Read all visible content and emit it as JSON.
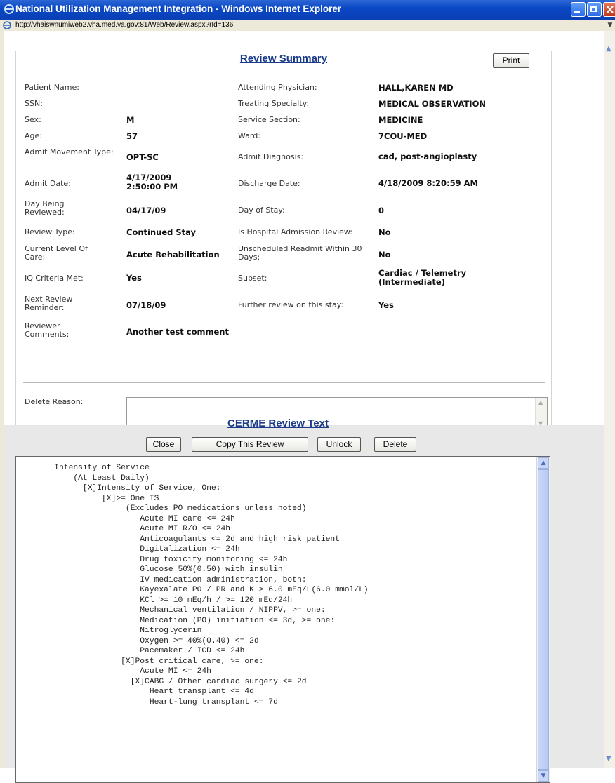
{
  "window": {
    "title": "National Utilization Management Integration - Windows Internet Explorer",
    "url": "http://vhaiswnumiweb2.vha.med.va.gov:81/Web/Review.aspx?rId=136"
  },
  "review_summary": {
    "heading": "Review Summary",
    "print_label": "Print",
    "left_fields": [
      {
        "label": "Patient Name:",
        "value": ""
      },
      {
        "label": "SSN:",
        "value": ""
      },
      {
        "label": "Sex:",
        "value": "M"
      },
      {
        "label": "Age:",
        "value": "57"
      },
      {
        "label": "Admit Movement Type:",
        "value": "OPT-SC"
      },
      {
        "label": "Admit Date:",
        "value": "4/17/2009 2:50:00 PM"
      },
      {
        "label": "Day Being Reviewed:",
        "value": "04/17/09"
      },
      {
        "label": "Review Type:",
        "value": "Continued Stay"
      },
      {
        "label": "Current Level Of Care:",
        "value": "Acute Rehabilitation"
      },
      {
        "label": "IQ Criteria Met:",
        "value": "Yes"
      },
      {
        "label": "Next Review Reminder:",
        "value": "07/18/09"
      },
      {
        "label": "Reviewer Comments:",
        "value": "Another test comment"
      }
    ],
    "right_fields": [
      {
        "label": "Attending Physician:",
        "value": "HALL,KAREN MD"
      },
      {
        "label": "Treating Specialty:",
        "value": "MEDICAL OBSERVATION"
      },
      {
        "label": "Service Section:",
        "value": "MEDICINE"
      },
      {
        "label": "Ward:",
        "value": "7COU-MED"
      },
      {
        "label": "Admit Diagnosis:",
        "value": "cad, post-angioplasty"
      },
      {
        "label": "Discharge Date:",
        "value": "4/18/2009 8:20:59 AM"
      },
      {
        "label": "Day of Stay:",
        "value": "0"
      },
      {
        "label": "Is Hospital Admission Review:",
        "value": "No"
      },
      {
        "label": "Unscheduled Readmit Within 30 Days:",
        "value": "No"
      },
      {
        "label": "Subset:",
        "value": "Cardiac / Telemetry (Intermediate)"
      },
      {
        "label": "Further review on this stay:",
        "value": "Yes"
      }
    ],
    "delete_reason_label": "Delete Reason:",
    "delete_reason_value": ""
  },
  "actions": {
    "close": "Close",
    "copy": "Copy This Review",
    "unlock": "Unlock",
    "delete": "Delete"
  },
  "cerme": {
    "heading": "CERME Review Text",
    "lines": [
      "        Intensity of Service",
      "            (At Least Daily)",
      "              [X]Intensity of Service, One:",
      "                  [X]>= One IS",
      "                       (Excludes PO medications unless noted)",
      "                          Acute MI care <= 24h",
      "                          Acute MI R/O <= 24h",
      "                          Anticoagulants <= 2d and high risk patient",
      "                          Digitalization <= 24h",
      "                          Drug toxicity monitoring <= 24h",
      "                          Glucose 50%(0.50) with insulin",
      "                          IV medication administration, both:",
      "                          Kayexalate PO / PR and K > 6.0 mEq/L(6.0 mmol/L)",
      "                          KCl >= 10 mEq/h / >= 120 mEq/24h",
      "                          Mechanical ventilation / NIPPV, >= one:",
      "                          Medication (PO) initiation <= 3d, >= one:",
      "                          Nitroglycerin",
      "                          Oxygen >= 40%(0.40) <= 2d",
      "                          Pacemaker / ICD <= 24h",
      "                      [X]Post critical care, >= one:",
      "                          Acute MI <= 24h",
      "                        [X]CABG / Other cardiac surgery <= 2d",
      "                            Heart transplant <= 4d",
      "                            Heart-lung transplant <= 7d"
    ]
  }
}
